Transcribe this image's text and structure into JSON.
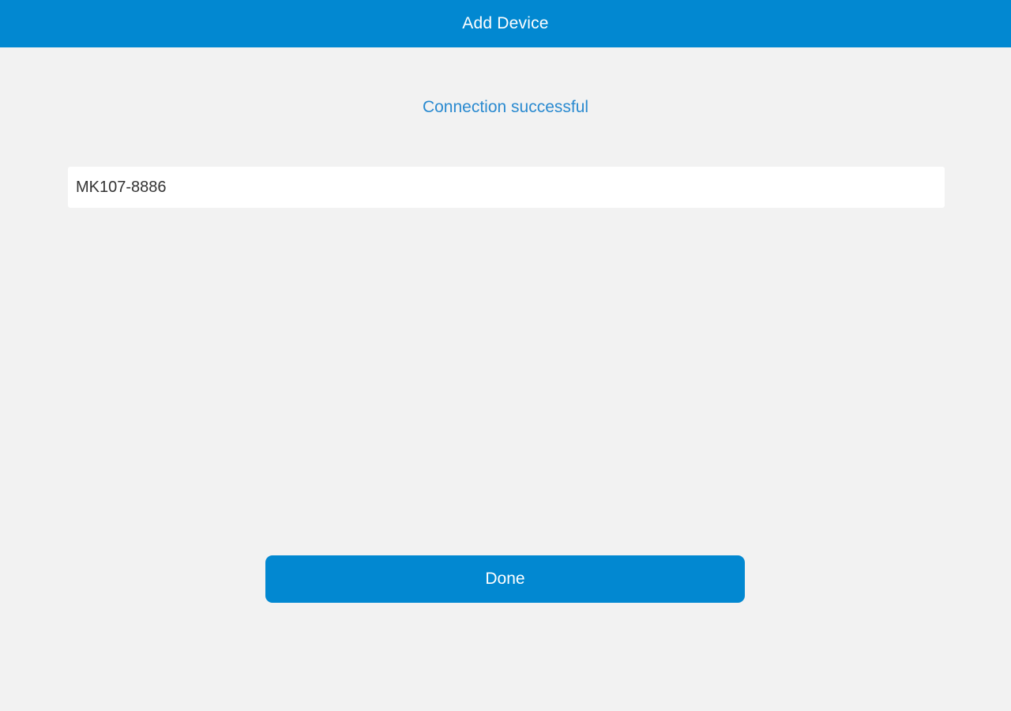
{
  "app_bar": {
    "title": "Add Device",
    "color": "#0288d1"
  },
  "status": {
    "message": "Connection successful",
    "color": "#2a8ad0"
  },
  "device_field": {
    "value": "MK107-8886"
  },
  "actions": {
    "done_label": "Done"
  },
  "colors": {
    "background": "#f2f2f2",
    "accent": "#0288d1"
  }
}
